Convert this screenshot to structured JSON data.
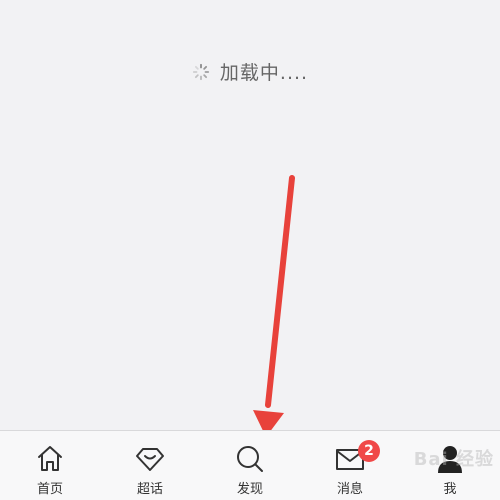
{
  "loading": {
    "text": "加载中...."
  },
  "tabbar": {
    "items": [
      {
        "label": "首页",
        "icon": "home-icon"
      },
      {
        "label": "超话",
        "icon": "diamond-icon"
      },
      {
        "label": "发现",
        "icon": "search-icon"
      },
      {
        "label": "消息",
        "icon": "mail-icon",
        "badge": "2"
      },
      {
        "label": "我",
        "icon": "profile-icon"
      }
    ]
  },
  "watermark": {
    "text": "Bai 经验"
  },
  "colors": {
    "arrow": "#e8423b",
    "badge": "#f04848",
    "background": "#f2f2f4"
  }
}
